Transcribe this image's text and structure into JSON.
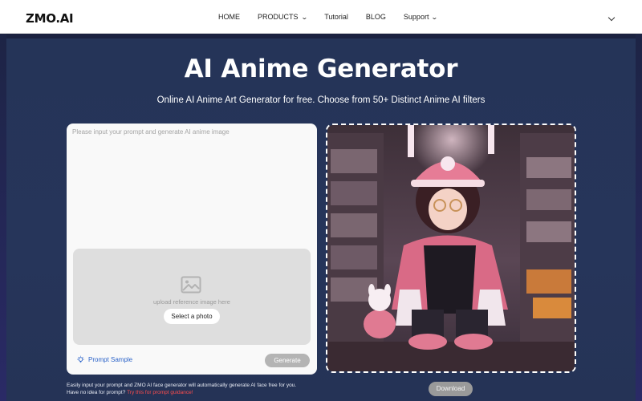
{
  "header": {
    "logo": "ZMO.AI",
    "nav": [
      {
        "label": "HOME"
      },
      {
        "label": "PRODUCTS",
        "dropdown": true
      },
      {
        "label": "Tutorial"
      },
      {
        "label": "BLOG"
      },
      {
        "label": "Support",
        "dropdown": true
      }
    ]
  },
  "hero": {
    "title": "AI Anime Generator",
    "subtitle": "Online AI Anime Art Generator for free. Choose from 50+ Distinct Anime AI filters"
  },
  "card": {
    "prompt_placeholder": "Please input your prompt and generate AI anime image",
    "upload_text": "upload reference image here",
    "select_photo": "Select a photo",
    "prompt_sample": "Prompt Sample",
    "generate": "Generate"
  },
  "note": {
    "line1": "Easily input your prompt and ZMO AI face generator will automatically generate AI face free for you.",
    "line2_prefix": "Have no idea for prompt?",
    "line2_link": "Try this for prompt guidance!"
  },
  "result": {
    "download": "Download"
  },
  "colors": {
    "hero_bg": "#253458",
    "link_red": "#ff4d4d",
    "prompt_sample_blue": "#2b63c9"
  }
}
